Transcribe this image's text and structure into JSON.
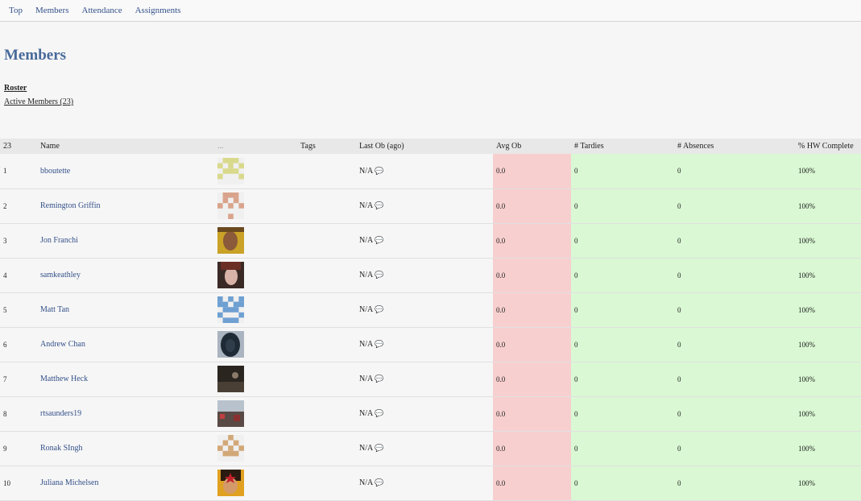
{
  "nav": [
    "Top",
    "Members",
    "Attendance",
    "Assignments"
  ],
  "page_title": "Members",
  "subnav": {
    "roster": "Roster",
    "active": "Active Members (23)"
  },
  "table": {
    "headers": [
      "23",
      "Name",
      "...",
      "Tags",
      "Last Ob (ago)",
      "Avg Ob",
      "# Tardies",
      "# Absences",
      "% HW Complete"
    ],
    "rows": [
      {
        "num": "1",
        "name": "bboutette",
        "last_ob": "N/A",
        "avg": "0.0",
        "tardies": "0",
        "absences": "0",
        "hw": "100%"
      },
      {
        "num": "2",
        "name": "Remington Griffin",
        "last_ob": "N/A",
        "avg": "0.0",
        "tardies": "0",
        "absences": "0",
        "hw": "100%"
      },
      {
        "num": "3",
        "name": "Jon Franchi",
        "last_ob": "N/A",
        "avg": "0.0",
        "tardies": "0",
        "absences": "0",
        "hw": "100%"
      },
      {
        "num": "4",
        "name": "samkeathley",
        "last_ob": "N/A",
        "avg": "0.0",
        "tardies": "0",
        "absences": "0",
        "hw": "100%"
      },
      {
        "num": "5",
        "name": "Matt Tan",
        "last_ob": "N/A",
        "avg": "0.0",
        "tardies": "0",
        "absences": "0",
        "hw": "100%"
      },
      {
        "num": "6",
        "name": "Andrew Chan",
        "last_ob": "N/A",
        "avg": "0.0",
        "tardies": "0",
        "absences": "0",
        "hw": "100%"
      },
      {
        "num": "7",
        "name": "Matthew Heck",
        "last_ob": "N/A",
        "avg": "0.0",
        "tardies": "0",
        "absences": "0",
        "hw": "100%"
      },
      {
        "num": "8",
        "name": "rtsaunders19",
        "last_ob": "N/A",
        "avg": "0.0",
        "tardies": "0",
        "absences": "0",
        "hw": "100%"
      },
      {
        "num": "9",
        "name": "Ronak SIngh",
        "last_ob": "N/A",
        "avg": "0.0",
        "tardies": "0",
        "absences": "0",
        "hw": "100%"
      },
      {
        "num": "10",
        "name": "Juliana Michelsen",
        "last_ob": "N/A",
        "avg": "0.0",
        "tardies": "0",
        "absences": "0",
        "hw": "100%"
      }
    ]
  },
  "colors": {
    "avg_bg": "#f8cfcf",
    "green_bg": "#d9f8d3",
    "link": "#34518a",
    "title": "#48699a"
  }
}
